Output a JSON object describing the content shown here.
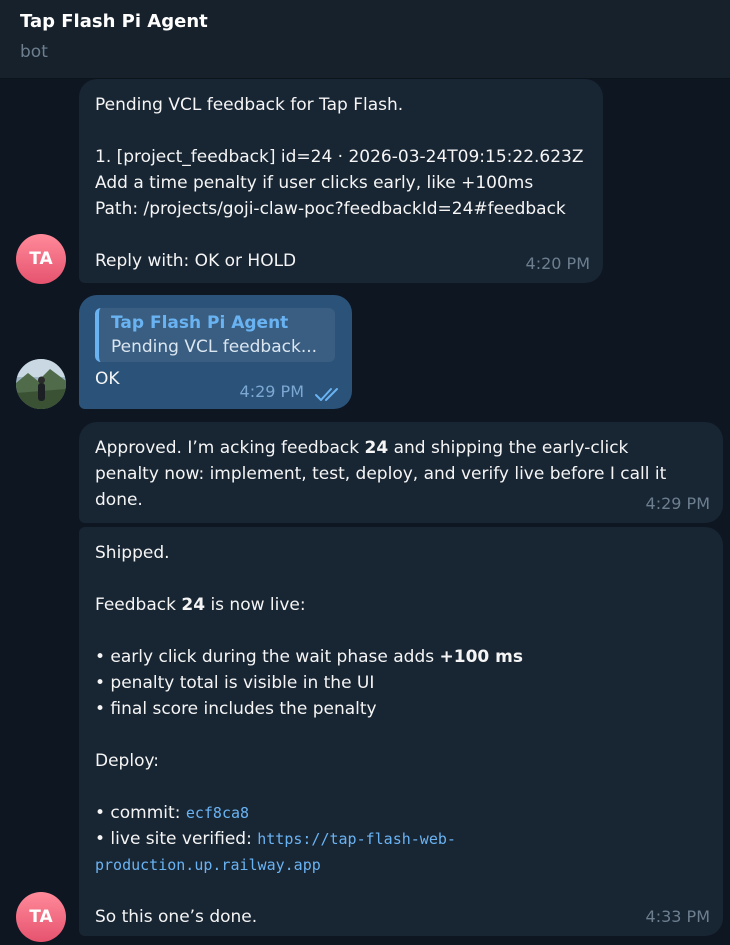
{
  "header": {
    "title": "Tap Flash Pi Agent",
    "subtitle": "bot"
  },
  "avatars": {
    "bot_initials": "TA",
    "bot_color": "#e6536e"
  },
  "messages": {
    "m1": {
      "line1": "Pending VCL feedback for Tap Flash.",
      "line2": "1. [project_feedback] id=24 · 2026-03-24T09:15:22.623Z",
      "line3": "Add a time penalty if user clicks early, like +100ms",
      "line4": "Path: /projects/goji-claw-poc?feedbackId=24#feedback",
      "line5": "Reply with: OK or HOLD",
      "time": "4:20 PM"
    },
    "m2": {
      "reply_to_name": "Tap Flash Pi Agent",
      "reply_to_text": "Pending VCL feedback...",
      "text": "OK",
      "time": "4:29 PM",
      "status_icon": "double-check-icon"
    },
    "m3": {
      "l1_pre": "Approved. I’m acking feedback ",
      "l1_bold": "24",
      "l1_post": " and shipping the early-click",
      "l2": "penalty now: implement, test, deploy, and verify live before I call it",
      "l3": "done.",
      "time": "4:29 PM"
    },
    "m4": {
      "shipped": "Shipped.",
      "fb_pre": "Feedback ",
      "fb_bold": "24",
      "fb_post": " is now live:",
      "b1_pre": "• early click during the wait phase adds ",
      "b1_bold": "+100 ms",
      "b2": "• penalty total is visible in the UI",
      "b3": "• final score includes the penalty",
      "deploy": "Deploy:",
      "commit_label": "• commit: ",
      "commit_hash": "ecf8ca8",
      "live_label": "• live site verified: ",
      "url_part1": "https://tap-flash-web-",
      "url_part2": "production.up.railway.app",
      "closing": "So this one’s done.",
      "time": "4:33 PM"
    }
  }
}
